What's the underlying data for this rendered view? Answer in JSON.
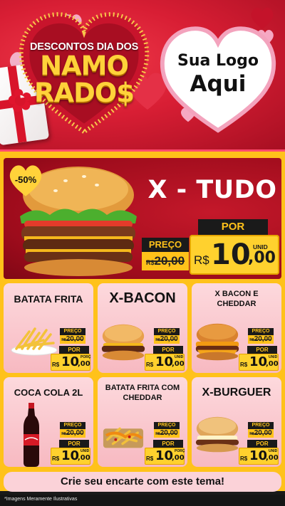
{
  "header": {
    "badge_top": "DESCONTOS DIA DOS",
    "badge_line1": "NAMO",
    "badge_line2": "RADO$",
    "logo_line1": "Sua Logo",
    "logo_line2": "Aqui"
  },
  "hero": {
    "discount": "-50%",
    "title": "X - TUDO",
    "preco_label": "PREÇO",
    "old_currency": "R$",
    "old_price": "20,00",
    "por_label": "POR",
    "currency": "R$",
    "price_int": "10",
    "price_cents": ",00",
    "unit": "UNID"
  },
  "products": [
    {
      "name": "BATATA FRITA",
      "preco_label": "PREÇO",
      "old_currency": "R$",
      "old_price": "20,00",
      "por_label": "POR",
      "currency": "R$",
      "price_int": "10",
      "price_cents": ",00",
      "unit": "PORÇ"
    },
    {
      "name": "X-BACON",
      "preco_label": "PREÇO",
      "old_currency": "R$",
      "old_price": "20,00",
      "por_label": "POR",
      "currency": "R$",
      "price_int": "10",
      "price_cents": ",00",
      "unit": "UNID"
    },
    {
      "name": "X BACON E CHEDDAR",
      "preco_label": "PREÇO",
      "old_currency": "R$",
      "old_price": "20,00",
      "por_label": "POR",
      "currency": "R$",
      "price_int": "10",
      "price_cents": ",00",
      "unit": "UNID"
    },
    {
      "name": "COCA COLA 2L",
      "preco_label": "PREÇO",
      "old_currency": "R$",
      "old_price": "20,00",
      "por_label": "POR",
      "currency": "R$",
      "price_int": "10",
      "price_cents": ",00",
      "unit": "UNID"
    },
    {
      "name": "BATATA FRITA COM CHEDDAR",
      "preco_label": "PREÇO",
      "old_currency": "R$",
      "old_price": "20,00",
      "por_label": "POR",
      "currency": "R$",
      "price_int": "10",
      "price_cents": ",00",
      "unit": "PORÇ"
    },
    {
      "name": "X-BURGUER",
      "preco_label": "PREÇO",
      "old_currency": "R$",
      "old_price": "20,00",
      "por_label": "POR",
      "currency": "R$",
      "price_int": "10",
      "price_cents": ",00",
      "unit": "UNID"
    }
  ],
  "banner": {
    "text": "Crie seu encarte com este tema!"
  },
  "footer": {
    "disclaimer": "*Imagens Meramente Ilustrativas"
  },
  "colors": {
    "background_red": "#d81e34",
    "panel_yellow": "#ffc21a",
    "price_yellow": "#ffd12e",
    "card_pink": "#fbd2d8",
    "label_black": "#1a1a1a"
  },
  "icons": [
    "heart-icon",
    "gift-icon",
    "burger-image",
    "fries-image",
    "soda-bottle-image"
  ]
}
